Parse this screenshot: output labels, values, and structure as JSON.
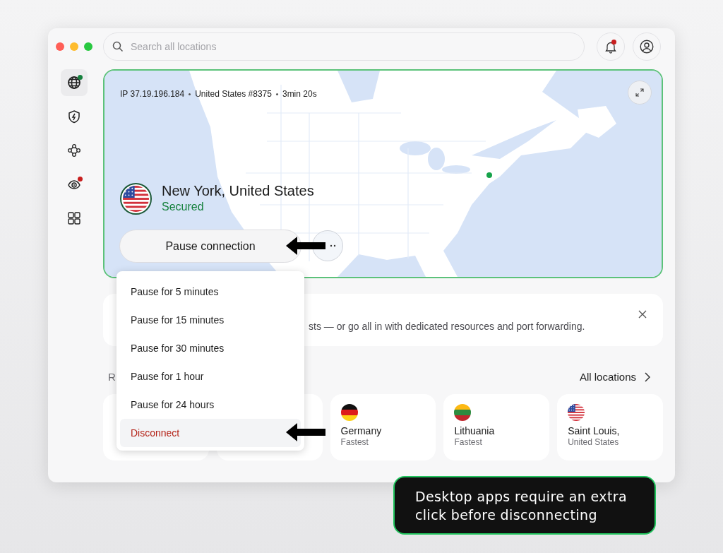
{
  "window": {
    "controls": [
      {
        "color": "#ff5f57"
      },
      {
        "color": "#febc2e"
      },
      {
        "color": "#28c840"
      }
    ]
  },
  "search": {
    "placeholder": "Search all locations"
  },
  "header_buttons": [
    {
      "kind": "bell",
      "badge": true
    },
    {
      "kind": "profile",
      "badge": false
    }
  ],
  "sidebar": {
    "items": [
      {
        "kind": "globe",
        "selected": true,
        "color": "#15803d"
      },
      {
        "kind": "shield",
        "selected": false
      },
      {
        "kind": "nodes",
        "selected": false
      },
      {
        "kind": "eye",
        "selected": false,
        "color": "#c81e1e"
      },
      {
        "kind": "grid",
        "selected": false
      }
    ]
  },
  "connection": {
    "ip": "IP 37.19.196.184",
    "server": "United States #8375",
    "duration": "3min 20s",
    "location": "New York, United States",
    "status": "Secured",
    "connected": true,
    "button": "Pause connection",
    "arrow": true
  },
  "menu": {
    "items": [
      {
        "label": "Pause for 5 minutes",
        "kind": "pause",
        "selected": false,
        "arrow": false
      },
      {
        "label": "Pause for 15 minutes",
        "kind": "pause",
        "selected": false,
        "arrow": false
      },
      {
        "label": "Pause for 30 minutes",
        "kind": "pause",
        "selected": false,
        "arrow": false
      },
      {
        "label": "Pause for 1 hour",
        "kind": "pause",
        "selected": false,
        "arrow": false
      },
      {
        "label": "Pause for 24 hours",
        "kind": "pause",
        "selected": false,
        "arrow": false
      },
      {
        "label": "Disconnect",
        "kind": "danger",
        "selected": true,
        "arrow": true
      }
    ]
  },
  "banner": {
    "text": "sts — or go all in with dedicated resources and port forwarding."
  },
  "recent": {
    "heading": "R",
    "link": "All locations",
    "cards": [
      {
        "kind": "covered"
      },
      {
        "kind": "covered"
      },
      {
        "kind": "de",
        "name": "Germany",
        "detail": "Fastest"
      },
      {
        "kind": "lt",
        "name": "Lithuania",
        "detail": "Fastest"
      },
      {
        "kind": "us",
        "name": "Saint Louis,",
        "detail": "United States"
      }
    ]
  },
  "callout": {
    "text": "Desktop apps require an extra click before disconnecting"
  }
}
